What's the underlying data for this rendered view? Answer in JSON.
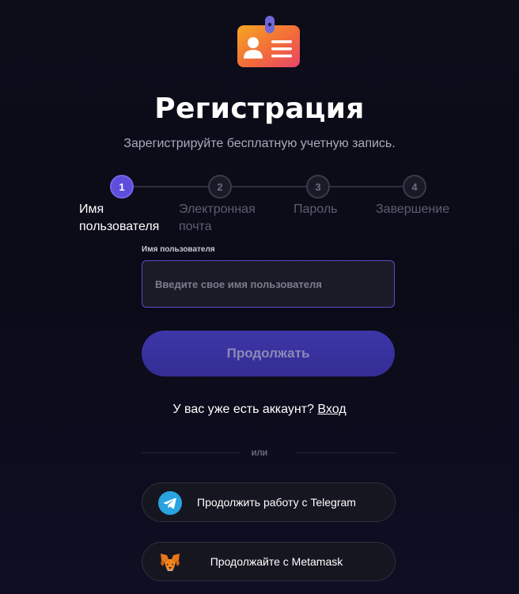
{
  "header": {
    "title": "Регистрация",
    "subtitle": "Зарегистрируйте бесплатную учетную запись."
  },
  "steps": [
    {
      "number": "1",
      "label": "Имя пользователя",
      "active": true
    },
    {
      "number": "2",
      "label": "Электронная почта",
      "active": false
    },
    {
      "number": "3",
      "label": "Пароль",
      "active": false
    },
    {
      "number": "4",
      "label": "Завершение",
      "active": false
    }
  ],
  "form": {
    "username_label": "Имя пользователя",
    "username_placeholder": "Введите свое имя пользователя",
    "username_value": "",
    "continue_label": "Продолжать"
  },
  "login": {
    "prompt": "У вас уже есть аккаунт?",
    "link": "Вход"
  },
  "divider_text": "или",
  "social": {
    "telegram_label": "Продолжить работу с Telegram",
    "metamask_label": "Продолжайте с Metamask"
  },
  "icons": {
    "logo": "id-card-icon",
    "telegram": "telegram-icon",
    "metamask": "metamask-fox-icon"
  },
  "colors": {
    "background": "#0d0d1a",
    "accent": "#5c4ddb",
    "button": "#3d36a8",
    "telegram": "#2aa3e0",
    "metamask": "#e2761b"
  }
}
